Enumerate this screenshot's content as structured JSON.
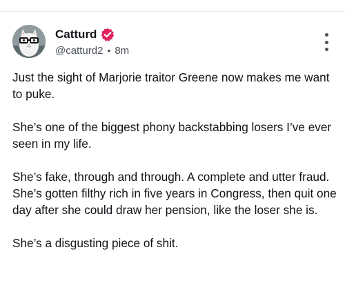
{
  "post": {
    "author": {
      "display_name": "Catturd",
      "handle": "@catturd2",
      "verified": true,
      "avatar_icon": "cat-with-glasses-avatar"
    },
    "separator": "•",
    "timestamp": "8m",
    "more_icon": "vertical-ellipsis-icon",
    "paragraphs": [
      "Just the sight of Marjorie traitor Greene now makes me want to puke.",
      "She’s one of the biggest phony backstabbing losers I’ve ever seen in my life.",
      "She’s fake, through and through. A complete and utter fraud.",
      "She’s gotten filthy rich in five years in Congress, then quit one day after she could draw her pension, like the loser she is.",
      "She’s a disgusting piece of shit."
    ]
  },
  "colors": {
    "text": "#111418",
    "secondary_text": "#4b5158",
    "verified_badge": "#e0245e",
    "divider": "#e6e8eb"
  }
}
